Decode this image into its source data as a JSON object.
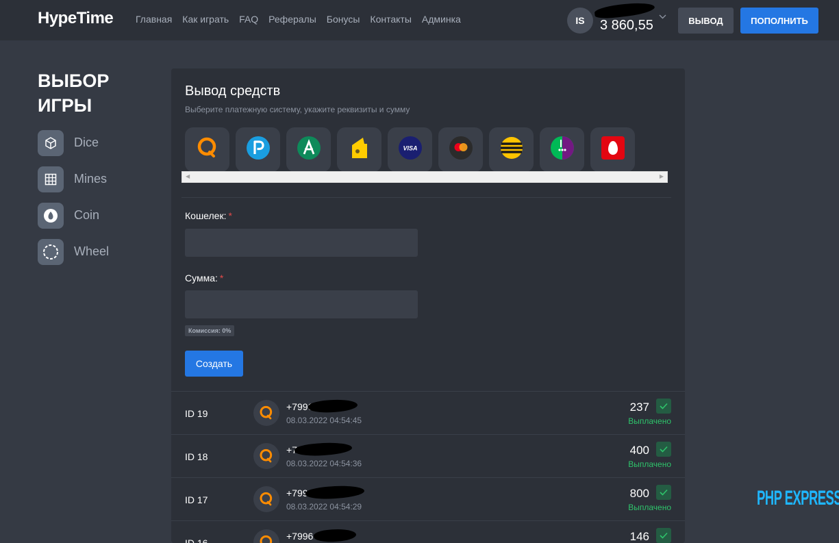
{
  "header": {
    "logo": "HypeTime",
    "nav": [
      "Главная",
      "Как играть",
      "FAQ",
      "Рефералы",
      "Бонусы",
      "Контакты",
      "Админка"
    ],
    "user": {
      "avatar_initials": "IS",
      "balance": "3 860,55"
    },
    "withdraw_label": "ВЫВОД",
    "deposit_label": "ПОПОЛНИТЬ"
  },
  "sidebar": {
    "title": "ВЫБОР ИГРЫ",
    "games": [
      {
        "label": "Dice",
        "icon": "cube-icon"
      },
      {
        "label": "Mines",
        "icon": "grid-icon"
      },
      {
        "label": "Coin",
        "icon": "coin-icon"
      },
      {
        "label": "Wheel",
        "icon": "wheel-icon"
      }
    ]
  },
  "withdrawal": {
    "title": "Вывод средств",
    "subtitle": "Выберите платежную систему, укажите реквизиты и сумму",
    "payment_methods": [
      {
        "icon": "qiwi-icon",
        "color": "#ff8c00"
      },
      {
        "icon": "payeer-icon",
        "color": "#1a9ee0"
      },
      {
        "icon": "advcash-icon",
        "color": "#0e8a5a"
      },
      {
        "icon": "yoomoney-icon",
        "color": "#ffcc00"
      },
      {
        "icon": "visa-icon",
        "color": "#1a1f71"
      },
      {
        "icon": "mastercard-icon",
        "color": "#eb001b"
      },
      {
        "icon": "beeline-icon",
        "color": "#ffc400"
      },
      {
        "icon": "megafon-icon",
        "color": "#00b956"
      },
      {
        "icon": "mts-icon",
        "color": "#e30611"
      }
    ],
    "wallet_label": "Кошелек:",
    "amount_label": "Сумма:",
    "required_mark": "*",
    "wallet_value": "",
    "amount_value": "",
    "fee": "Комиссия: 0%",
    "create_label": "Создать"
  },
  "history": [
    {
      "id": "ID 19",
      "wallet": "+7996",
      "date": "08.03.2022 04:54:45",
      "amount": "237",
      "status": "Выплачено"
    },
    {
      "id": "ID 18",
      "wallet": "+7",
      "date": "08.03.2022 04:54:36",
      "amount": "400",
      "status": "Выплачено"
    },
    {
      "id": "ID 17",
      "wallet": "+799",
      "date": "08.03.2022 04:54:29",
      "amount": "800",
      "status": "Выплачено"
    },
    {
      "id": "ID 16",
      "wallet": "+7996",
      "date": "",
      "amount": "146",
      "status": ""
    }
  ],
  "colors": {
    "accent": "#2477e3",
    "success": "#2ec46b",
    "background": "#353a44",
    "panel": "#2c3038"
  },
  "watermark": "PHP EXPRESS"
}
